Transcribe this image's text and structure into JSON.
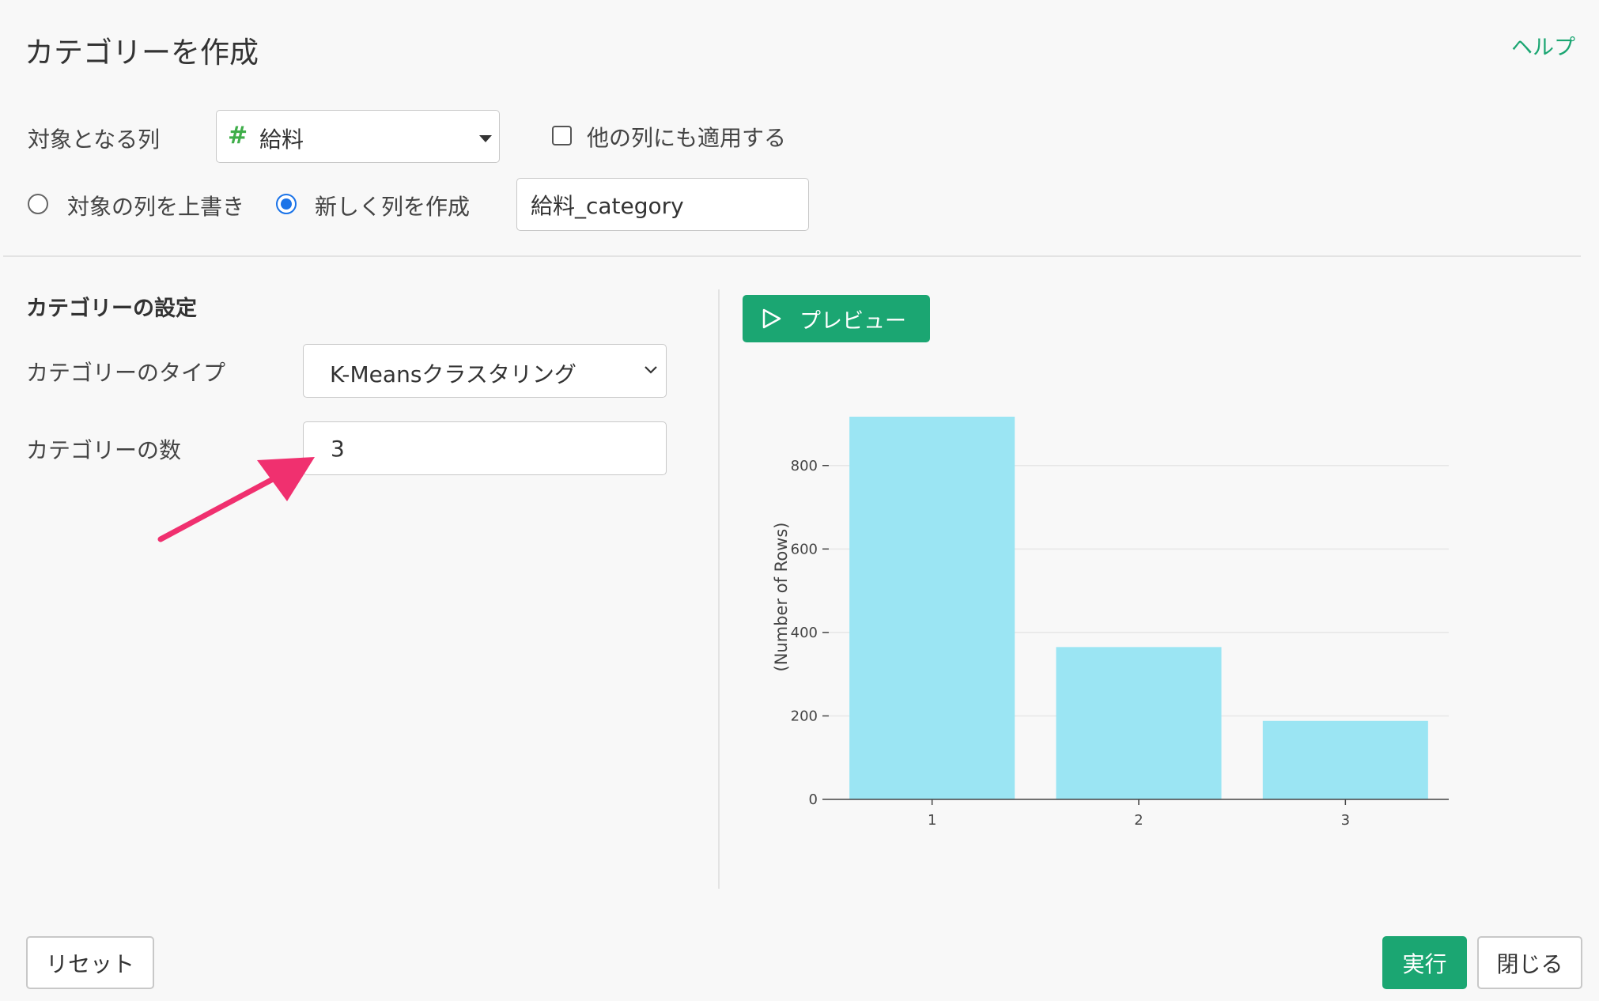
{
  "dialog": {
    "title": "カテゴリーを作成",
    "help_label": "ヘルプ"
  },
  "target": {
    "label": "対象となる列",
    "column_icon": "hash-icon",
    "column_value": "給料",
    "apply_other_label": "他の列にも適用する",
    "apply_other_checked": false
  },
  "output": {
    "overwrite_label": "対象の列を上書き",
    "new_column_label": "新しく列を作成",
    "selected": "new_column",
    "new_column_name": "給料_category"
  },
  "settings": {
    "section_title": "カテゴリーの設定",
    "type_label": "カテゴリーのタイプ",
    "type_value": "K-Meansクラスタリング",
    "count_label": "カテゴリーの数",
    "count_value": "3"
  },
  "preview": {
    "button_label": "プレビュー"
  },
  "chart_data": {
    "type": "bar",
    "categories": [
      "1",
      "2",
      "3"
    ],
    "values": [
      917,
      365,
      188
    ],
    "ylabel": "(Number of Rows)",
    "yticks": [
      0,
      200,
      400,
      600,
      800
    ],
    "ylim": [
      0,
      917
    ],
    "bar_color": "#9be5f3",
    "grid": true
  },
  "footer": {
    "reset_label": "リセット",
    "run_label": "実行",
    "close_label": "閉じる"
  },
  "colors": {
    "accent": "#1ba672",
    "arrow": "#f0306f",
    "radio_selected": "#1a73e8"
  }
}
